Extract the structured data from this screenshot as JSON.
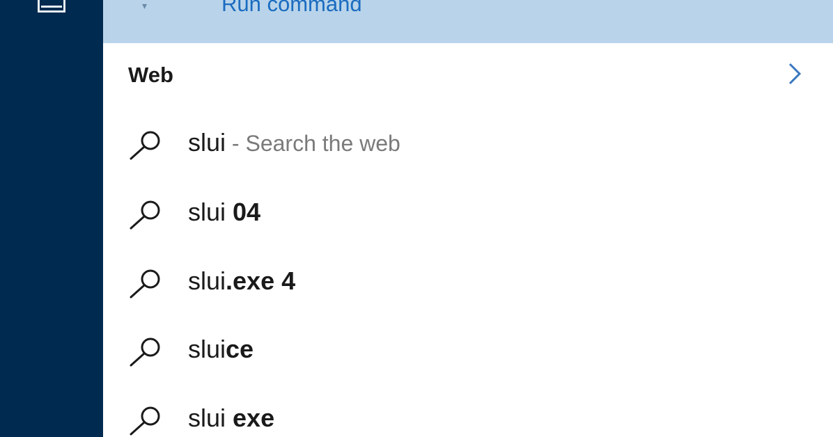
{
  "best_match": {
    "label": "Run command"
  },
  "web_section": {
    "title": "Web"
  },
  "results": [
    {
      "prefix": "slui",
      "bold": "",
      "suffix": " - Search the web"
    },
    {
      "prefix": "slui ",
      "bold": "04",
      "suffix": ""
    },
    {
      "prefix": "slui",
      "bold": ".exe 4",
      "suffix": ""
    },
    {
      "prefix": "slui",
      "bold": "ce",
      "suffix": ""
    },
    {
      "prefix": "slui ",
      "bold": "exe",
      "suffix": ""
    }
  ],
  "colors": {
    "rail": "#002a50",
    "highlight": "#b9d4ea",
    "link": "#1a6cc0"
  }
}
